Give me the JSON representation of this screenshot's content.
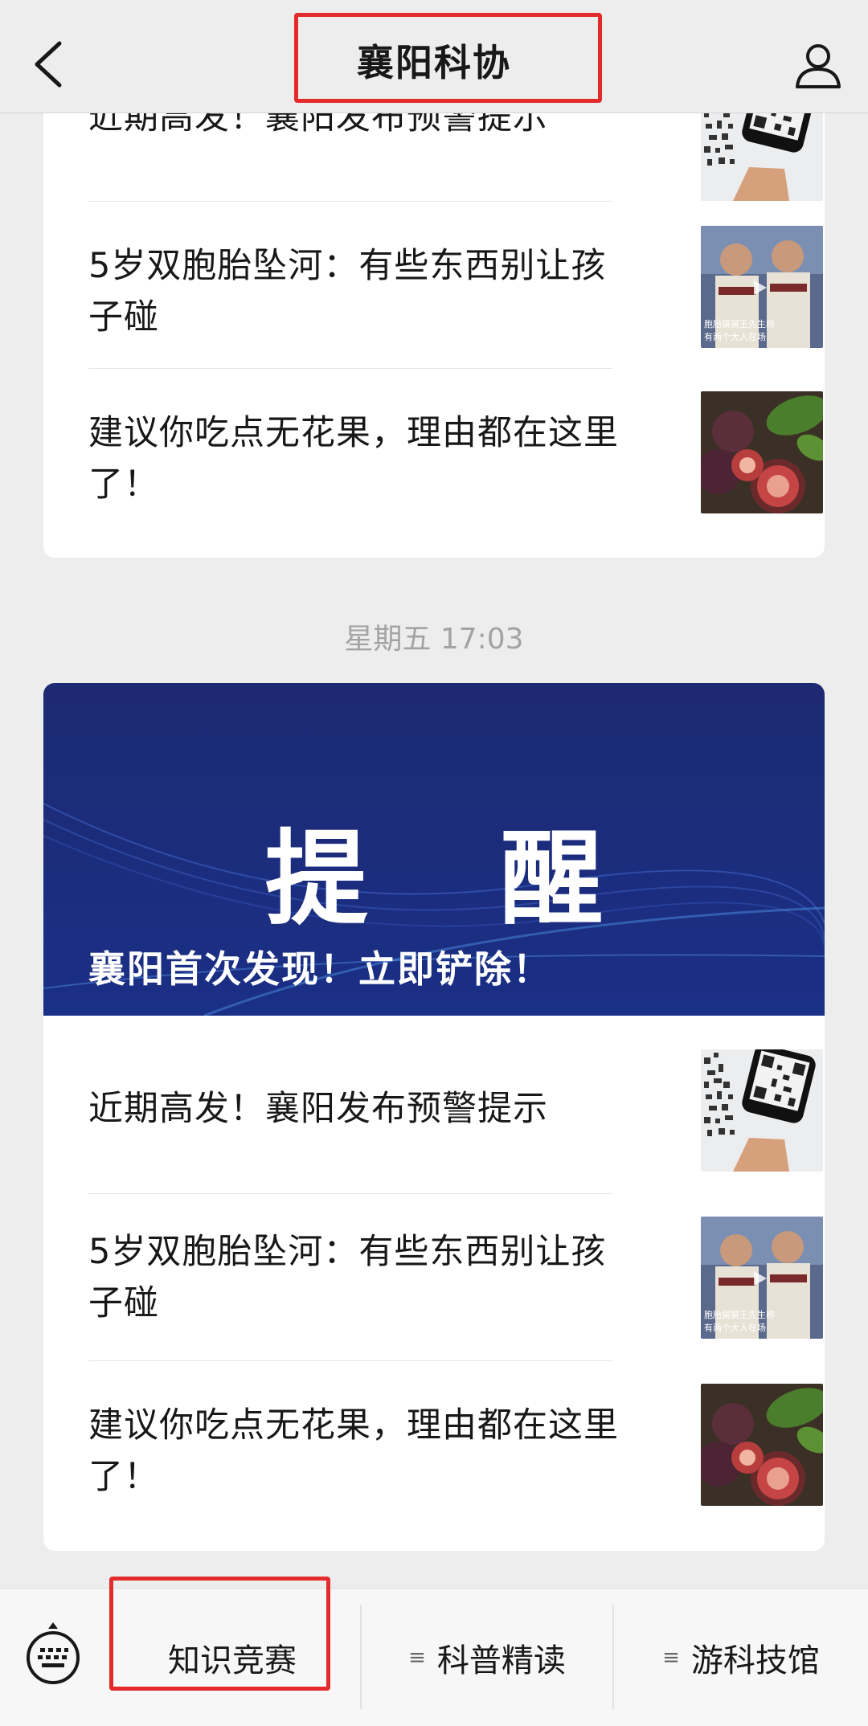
{
  "header": {
    "title": "襄阳科协"
  },
  "feed_top": {
    "items": [
      {
        "title": "近期高发！襄阳发布预警提示"
      },
      {
        "title": "5岁双胞胎坠河：有些东西别让孩子碰",
        "thumb_text": [
          "胞胎舅舅王先生称",
          "有两个大人在场"
        ]
      },
      {
        "title": "建议你吃点无花果，理由都在这里了！"
      }
    ]
  },
  "timestamp": "星期五 17:03",
  "feed_main": {
    "banner": {
      "heading": "提 醒",
      "subtitle": "襄阳首次发现！立即铲除！"
    },
    "items": [
      {
        "title": "近期高发！襄阳发布预警提示"
      },
      {
        "title": "5岁双胞胎坠河：有些东西别让孩子碰",
        "thumb_text": [
          "胞胎舅舅王先生称",
          "有两个大人在场"
        ]
      },
      {
        "title": "建议你吃点无花果，理由都在这里了！"
      }
    ]
  },
  "bottom_menu": {
    "items": [
      {
        "label": "知识竞赛"
      },
      {
        "label": "科普精读"
      },
      {
        "label": "游科技馆"
      }
    ]
  },
  "colors": {
    "highlight": "#e42b2b",
    "banner_bg": "#1f2d78"
  }
}
